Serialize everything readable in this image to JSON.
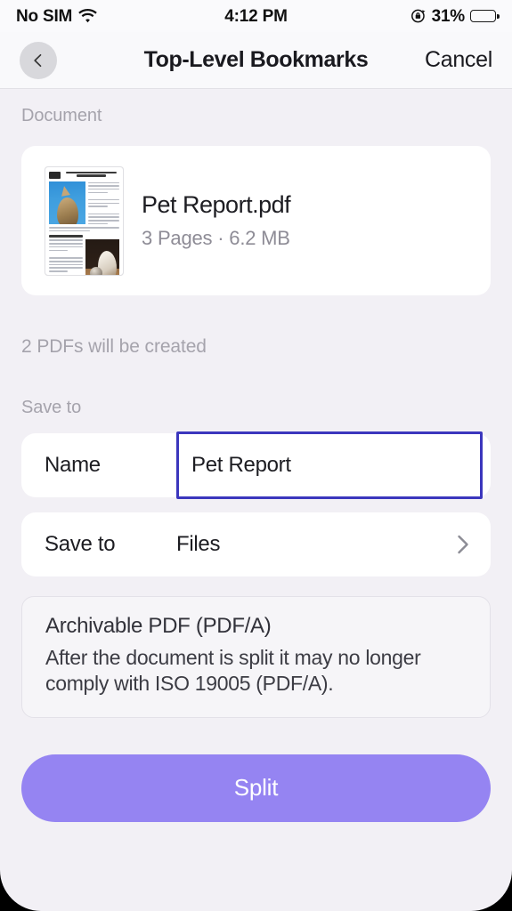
{
  "status_bar": {
    "carrier": "No SIM",
    "wifi_icon": "wifi-icon",
    "time": "4:12 PM",
    "rotation_lock_icon": "rotation-lock-icon",
    "battery_percent": "31%",
    "battery_level": 31
  },
  "nav_bar": {
    "back_icon": "chevron-left-icon",
    "title": "Top-Level Bookmarks",
    "cancel_label": "Cancel"
  },
  "document_section": {
    "label": "Document",
    "thumbnail_icon": "pdf-page-thumbnail",
    "file_name": "Pet Report.pdf",
    "page_count": "3 Pages",
    "file_size": "6.2 MB",
    "meta": "3 Pages · 6.2 MB"
  },
  "created_note": "2 PDFs will be created",
  "save_section": {
    "label": "Save to",
    "name_row": {
      "label": "Name",
      "value": "Pet Report",
      "placeholder": "Name",
      "focus_border_color": "#3b36bd"
    },
    "destination_row": {
      "label": "Save to",
      "value": "Files",
      "chevron_icon": "chevron-right-icon"
    }
  },
  "info_box": {
    "title": "Archivable PDF (PDF/A)",
    "text": "After the document is split it may no longer comply with ISO 19005 (PDF/A)."
  },
  "primary_action": {
    "label": "Split",
    "color": "#9584f2"
  },
  "colors": {
    "background": "#f2f0f5",
    "card": "#ffffff",
    "nav_bar": "#f9f9fb",
    "accent_purple": "#9584f2",
    "focus_indigo": "#3b36bd",
    "muted_text": "#a5a3ac"
  }
}
